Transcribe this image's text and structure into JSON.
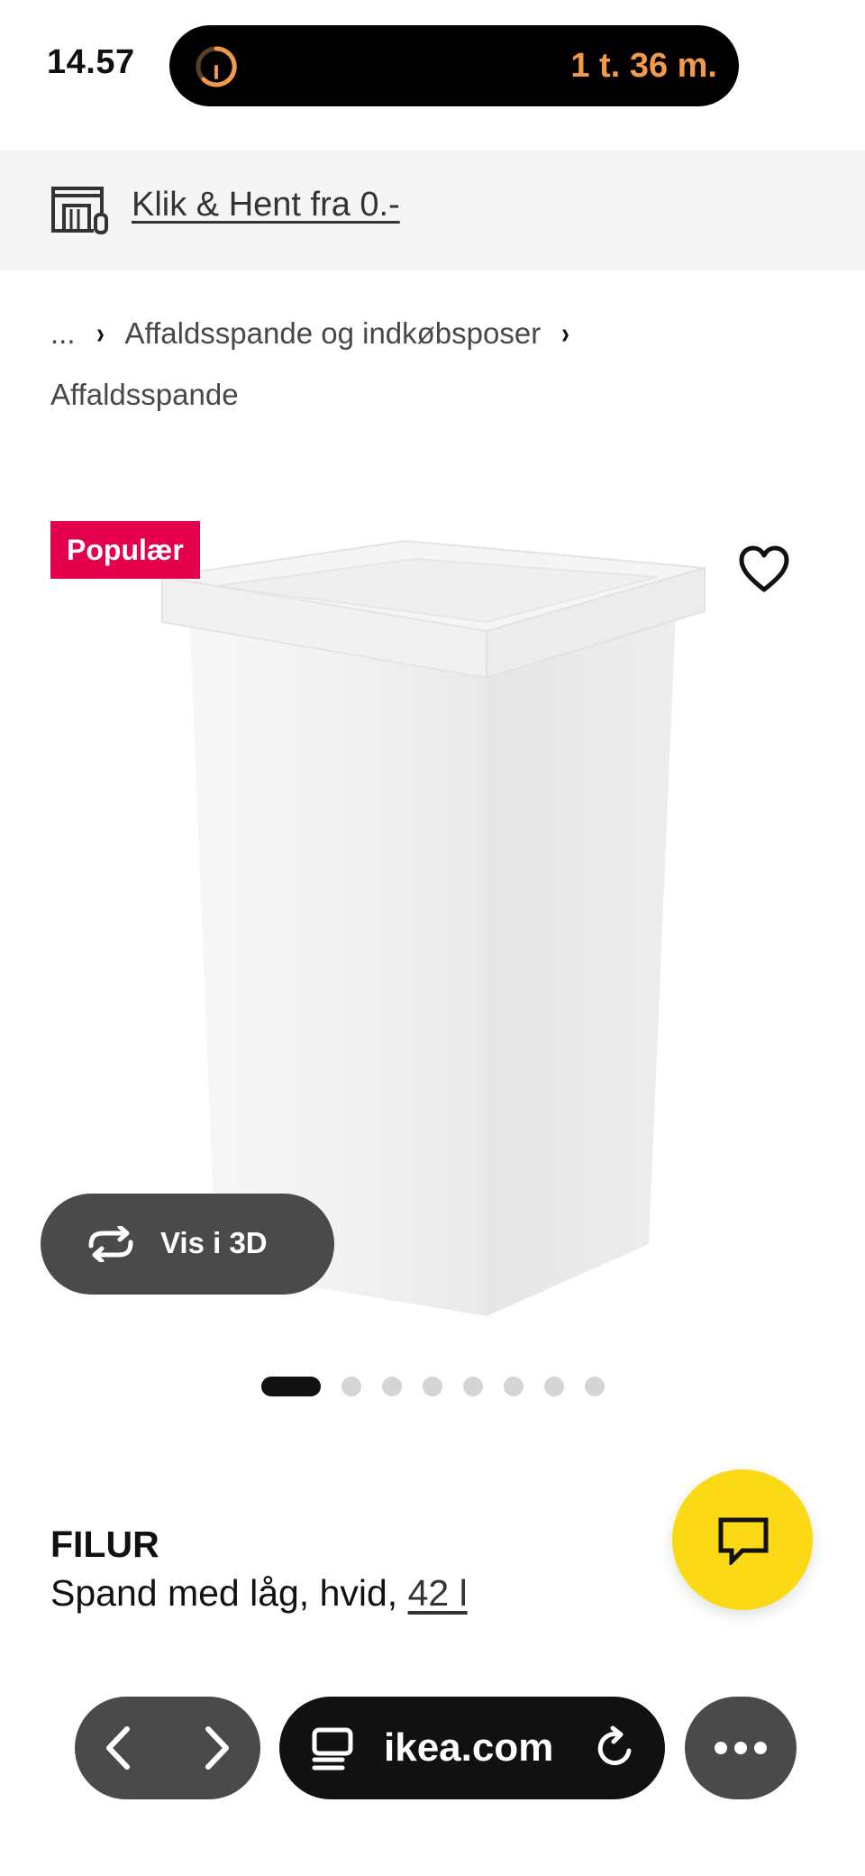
{
  "status_bar": {
    "time": "14.57",
    "timer_text": "1 t. 36 m.",
    "timer_icon": "timer-ring-icon",
    "accent_color": "#f2994a"
  },
  "banner": {
    "icon": "store-pickup-icon",
    "link_text": "Klik & Hent fra 0.-"
  },
  "breadcrumb": {
    "items": [
      "...",
      "Affaldsspande og indkøbsposer",
      "Affaldsspande"
    ],
    "separator": "›"
  },
  "product": {
    "badge": "Populær",
    "badge_color": "#e4004b",
    "favorite_icon": "heart-icon",
    "view_3d_label": "Vis i 3D",
    "view_3d_icon": "rotate-3d-icon",
    "image_count": 8,
    "active_image": 1,
    "name": "FILUR",
    "description": "Spand med låg, hvid, ",
    "size_link": "42 l"
  },
  "chat": {
    "icon": "chat-bubble-icon",
    "color": "#fbd914"
  },
  "browser": {
    "back_icon": "chevron-left-icon",
    "forward_icon": "chevron-right-icon",
    "page_icon": "page-menu-icon",
    "url": "ikea.com",
    "reload_icon": "reload-icon",
    "more_icon": "more-dots-icon"
  }
}
